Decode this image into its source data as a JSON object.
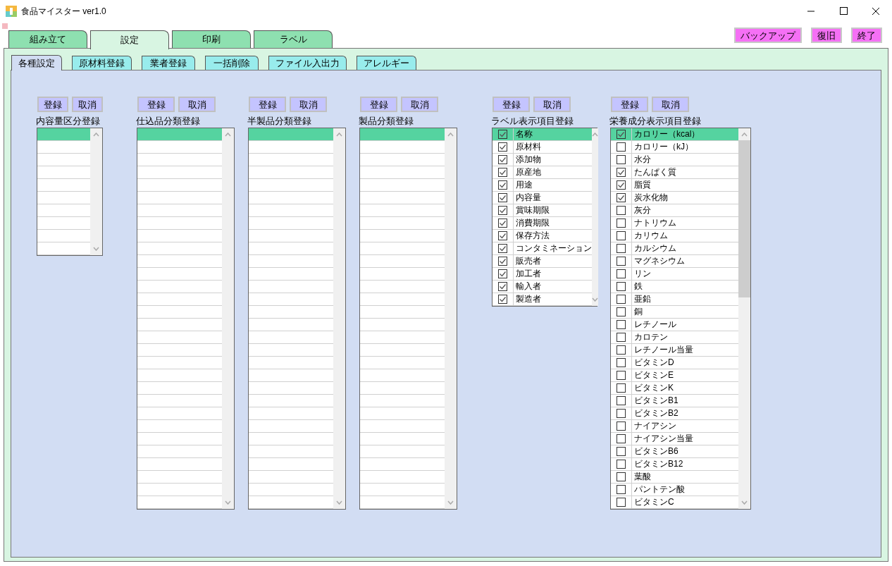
{
  "window": {
    "title": "食品マイスター ver1.0"
  },
  "main_tabs": [
    {
      "label": "組み立て",
      "selected": false
    },
    {
      "label": "設定",
      "selected": true
    },
    {
      "label": "印刷",
      "selected": false
    },
    {
      "label": "ラベル",
      "selected": false
    }
  ],
  "top_buttons": [
    "バックアップ",
    "復旧",
    "終了"
  ],
  "sub_tabs": [
    {
      "label": "各種設定",
      "selected": true
    },
    {
      "label": "原材料登録",
      "selected": false
    },
    {
      "label": "業者登録",
      "selected": false
    },
    {
      "label": "一括削除",
      "selected": false
    },
    {
      "label": "ファイル入出力",
      "selected": false
    },
    {
      "label": "アレルギー",
      "selected": false
    }
  ],
  "panels": [
    {
      "kind": "plain",
      "register": "登録",
      "cancel": "取消",
      "title": "内容量区分登録",
      "rows": [
        {
          "selected": true
        },
        {
          "selected": false
        },
        {
          "selected": false
        },
        {
          "selected": false
        },
        {
          "selected": false
        },
        {
          "selected": false
        },
        {
          "selected": false
        },
        {
          "selected": false
        },
        {
          "selected": false
        },
        {
          "selected": false
        }
      ]
    },
    {
      "kind": "plain",
      "register": "登録",
      "cancel": "取消",
      "title": "仕込品分類登録",
      "rows": [
        {
          "selected": true
        },
        {
          "selected": false
        },
        {
          "selected": false
        },
        {
          "selected": false
        },
        {
          "selected": false
        },
        {
          "selected": false
        },
        {
          "selected": false
        },
        {
          "selected": false
        },
        {
          "selected": false
        },
        {
          "selected": false
        },
        {
          "selected": false
        },
        {
          "selected": false
        },
        {
          "selected": false
        },
        {
          "selected": false
        },
        {
          "selected": false
        },
        {
          "selected": false
        },
        {
          "selected": false
        },
        {
          "selected": false
        },
        {
          "selected": false
        },
        {
          "selected": false
        },
        {
          "selected": false
        },
        {
          "selected": false
        },
        {
          "selected": false
        },
        {
          "selected": false
        },
        {
          "selected": false
        },
        {
          "selected": false
        },
        {
          "selected": false
        },
        {
          "selected": false
        },
        {
          "selected": false
        },
        {
          "selected": false
        }
      ]
    },
    {
      "kind": "plain",
      "register": "登録",
      "cancel": "取消",
      "title": "半製品分類登録",
      "rows": [
        {
          "selected": true
        },
        {
          "selected": false
        },
        {
          "selected": false
        },
        {
          "selected": false
        },
        {
          "selected": false
        },
        {
          "selected": false
        },
        {
          "selected": false
        },
        {
          "selected": false
        },
        {
          "selected": false
        },
        {
          "selected": false
        },
        {
          "selected": false
        },
        {
          "selected": false
        },
        {
          "selected": false
        },
        {
          "selected": false
        },
        {
          "selected": false
        },
        {
          "selected": false
        },
        {
          "selected": false
        },
        {
          "selected": false
        },
        {
          "selected": false
        },
        {
          "selected": false
        },
        {
          "selected": false
        },
        {
          "selected": false
        },
        {
          "selected": false
        },
        {
          "selected": false
        },
        {
          "selected": false
        },
        {
          "selected": false
        },
        {
          "selected": false
        },
        {
          "selected": false
        },
        {
          "selected": false
        },
        {
          "selected": false
        }
      ]
    },
    {
      "kind": "plain",
      "register": "登録",
      "cancel": "取消",
      "title": "製品分類登録",
      "rows": [
        {
          "selected": true
        },
        {
          "selected": false
        },
        {
          "selected": false
        },
        {
          "selected": false
        },
        {
          "selected": false
        },
        {
          "selected": false
        },
        {
          "selected": false
        },
        {
          "selected": false
        },
        {
          "selected": false
        },
        {
          "selected": false
        },
        {
          "selected": false
        },
        {
          "selected": false
        },
        {
          "selected": false
        },
        {
          "selected": false
        },
        {
          "selected": false
        },
        {
          "selected": false
        },
        {
          "selected": false
        },
        {
          "selected": false
        },
        {
          "selected": false
        },
        {
          "selected": false
        },
        {
          "selected": false
        },
        {
          "selected": false
        },
        {
          "selected": false
        },
        {
          "selected": false
        },
        {
          "selected": false
        },
        {
          "selected": false
        },
        {
          "selected": false
        },
        {
          "selected": false
        },
        {
          "selected": false
        },
        {
          "selected": false
        }
      ]
    },
    {
      "kind": "checklist",
      "register": "登録",
      "cancel": "取消",
      "title": "ラベル表示項目登録",
      "rows": [
        {
          "label": "名称",
          "checked": true,
          "selected": true
        },
        {
          "label": "原材料",
          "checked": true,
          "selected": false
        },
        {
          "label": "添加物",
          "checked": true,
          "selected": false
        },
        {
          "label": "原産地",
          "checked": true,
          "selected": false
        },
        {
          "label": "用途",
          "checked": true,
          "selected": false
        },
        {
          "label": "内容量",
          "checked": true,
          "selected": false
        },
        {
          "label": "賞味期限",
          "checked": true,
          "selected": false
        },
        {
          "label": "消費期限",
          "checked": true,
          "selected": false
        },
        {
          "label": "保存方法",
          "checked": true,
          "selected": false
        },
        {
          "label": "コンタミネーション",
          "checked": true,
          "selected": false
        },
        {
          "label": "販売者",
          "checked": true,
          "selected": false
        },
        {
          "label": "加工者",
          "checked": true,
          "selected": false
        },
        {
          "label": "輸入者",
          "checked": true,
          "selected": false
        },
        {
          "label": "製造者",
          "checked": true,
          "selected": false
        }
      ]
    },
    {
      "kind": "checklist",
      "register": "登録",
      "cancel": "取消",
      "title": "栄養成分表示項目登録",
      "rows": [
        {
          "label": "カロリー（kcal）",
          "checked": true,
          "selected": true
        },
        {
          "label": "カロリー（kJ）",
          "checked": false,
          "selected": false
        },
        {
          "label": "水分",
          "checked": false,
          "selected": false
        },
        {
          "label": "たんぱく質",
          "checked": true,
          "selected": false
        },
        {
          "label": "脂質",
          "checked": true,
          "selected": false
        },
        {
          "label": "炭水化物",
          "checked": true,
          "selected": false
        },
        {
          "label": "灰分",
          "checked": false,
          "selected": false
        },
        {
          "label": "ナトリウム",
          "checked": false,
          "selected": false
        },
        {
          "label": "カリウム",
          "checked": false,
          "selected": false
        },
        {
          "label": "カルシウム",
          "checked": false,
          "selected": false
        },
        {
          "label": "マグネシウム",
          "checked": false,
          "selected": false
        },
        {
          "label": "リン",
          "checked": false,
          "selected": false
        },
        {
          "label": "鉄",
          "checked": false,
          "selected": false
        },
        {
          "label": "亜鉛",
          "checked": false,
          "selected": false
        },
        {
          "label": "銅",
          "checked": false,
          "selected": false
        },
        {
          "label": "レチノール",
          "checked": false,
          "selected": false
        },
        {
          "label": "カロテン",
          "checked": false,
          "selected": false
        },
        {
          "label": "レチノール当量",
          "checked": false,
          "selected": false
        },
        {
          "label": "ビタミンD",
          "checked": false,
          "selected": false
        },
        {
          "label": "ビタミンE",
          "checked": false,
          "selected": false
        },
        {
          "label": "ビタミンK",
          "checked": false,
          "selected": false
        },
        {
          "label": "ビタミンB1",
          "checked": false,
          "selected": false
        },
        {
          "label": "ビタミンB2",
          "checked": false,
          "selected": false
        },
        {
          "label": "ナイアシン",
          "checked": false,
          "selected": false
        },
        {
          "label": "ナイアシン当量",
          "checked": false,
          "selected": false
        },
        {
          "label": "ビタミンB6",
          "checked": false,
          "selected": false
        },
        {
          "label": "ビタミンB12",
          "checked": false,
          "selected": false
        },
        {
          "label": "葉酸",
          "checked": false,
          "selected": false
        },
        {
          "label": "パントテン酸",
          "checked": false,
          "selected": false
        },
        {
          "label": "ビタミンC",
          "checked": false,
          "selected": false
        }
      ]
    }
  ]
}
